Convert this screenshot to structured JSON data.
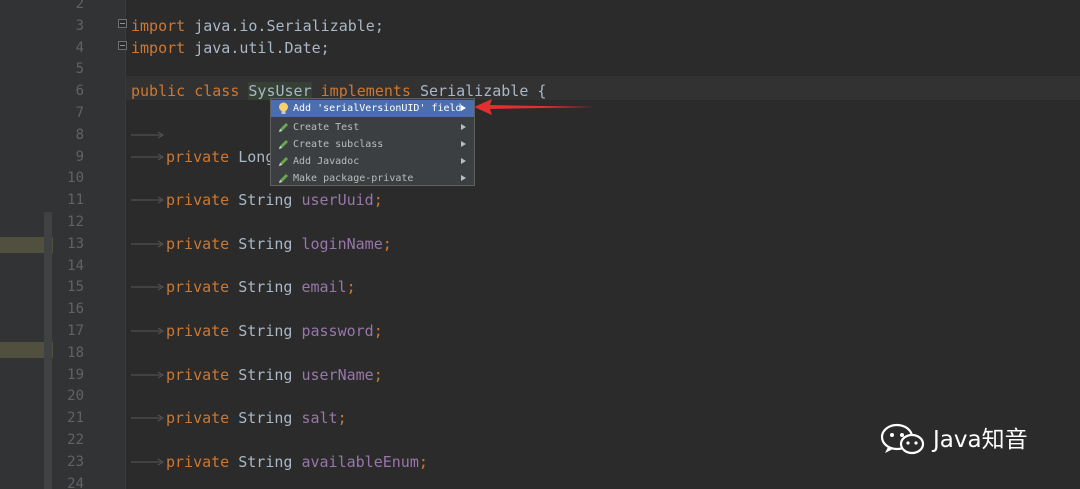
{
  "editor": {
    "lines": [
      {
        "no": "2",
        "tokens": []
      },
      {
        "no": "3",
        "tokens": [
          {
            "t": "import",
            "c": "kw"
          },
          {
            "t": " java.io.Serializable;",
            "c": "p"
          }
        ]
      },
      {
        "no": "4",
        "tokens": [
          {
            "t": "import",
            "c": "kw"
          },
          {
            "t": " java.util.Date;",
            "c": "p"
          }
        ]
      },
      {
        "no": "5",
        "tokens": []
      },
      {
        "no": "6",
        "tokens": [
          {
            "t": "public",
            "c": "kw"
          },
          {
            "t": " ",
            "c": "p"
          },
          {
            "t": "class",
            "c": "kw"
          },
          {
            "t": " ",
            "c": "p"
          },
          {
            "t": "SysUser",
            "c": "cls-hl"
          },
          {
            "t": " ",
            "c": "p"
          },
          {
            "t": "implements",
            "c": "kw"
          },
          {
            "t": " Serializable {",
            "c": "p"
          }
        ]
      },
      {
        "no": "7",
        "tokens": []
      },
      {
        "no": "8",
        "tokens": []
      },
      {
        "no": "9",
        "tokens": [
          {
            "t": "private",
            "c": "kw"
          },
          {
            "t": " Long",
            "c": "p"
          }
        ]
      },
      {
        "no": "10",
        "tokens": []
      },
      {
        "no": "11",
        "tokens": [
          {
            "t": "private",
            "c": "kw"
          },
          {
            "t": " String ",
            "c": "p"
          },
          {
            "t": "userUuid",
            "c": "fld"
          },
          {
            "t": ";",
            "c": "kw"
          }
        ]
      },
      {
        "no": "12",
        "tokens": []
      },
      {
        "no": "13",
        "tokens": [
          {
            "t": "private",
            "c": "kw"
          },
          {
            "t": " String ",
            "c": "p"
          },
          {
            "t": "loginName",
            "c": "fld"
          },
          {
            "t": ";",
            "c": "kw"
          }
        ]
      },
      {
        "no": "14",
        "tokens": []
      },
      {
        "no": "15",
        "tokens": [
          {
            "t": "private",
            "c": "kw"
          },
          {
            "t": " String ",
            "c": "p"
          },
          {
            "t": "email",
            "c": "fld"
          },
          {
            "t": ";",
            "c": "kw"
          }
        ]
      },
      {
        "no": "16",
        "tokens": []
      },
      {
        "no": "17",
        "tokens": [
          {
            "t": "private",
            "c": "kw"
          },
          {
            "t": " String ",
            "c": "p"
          },
          {
            "t": "password",
            "c": "fld"
          },
          {
            "t": ";",
            "c": "kw"
          }
        ]
      },
      {
        "no": "18",
        "tokens": []
      },
      {
        "no": "19",
        "tokens": [
          {
            "t": "private",
            "c": "kw"
          },
          {
            "t": " String ",
            "c": "p"
          },
          {
            "t": "userName",
            "c": "fld"
          },
          {
            "t": ";",
            "c": "kw"
          }
        ]
      },
      {
        "no": "20",
        "tokens": []
      },
      {
        "no": "21",
        "tokens": [
          {
            "t": "private",
            "c": "kw"
          },
          {
            "t": " String ",
            "c": "p"
          },
          {
            "t": "salt",
            "c": "fld"
          },
          {
            "t": ";",
            "c": "kw"
          }
        ]
      },
      {
        "no": "22",
        "tokens": []
      },
      {
        "no": "23",
        "tokens": [
          {
            "t": "private",
            "c": "kw"
          },
          {
            "t": " String ",
            "c": "p"
          },
          {
            "t": "availableEnum",
            "c": "fld"
          },
          {
            "t": ";",
            "c": "kw"
          }
        ]
      },
      {
        "no": "24",
        "tokens": []
      }
    ]
  },
  "intention_popup": {
    "items": [
      {
        "label": "Add 'serialVersionUID' field",
        "icon": "lightbulb-icon",
        "selected": true
      },
      {
        "label": "Create Test",
        "icon": "pencil-icon",
        "selected": false
      },
      {
        "label": "Create subclass",
        "icon": "pencil-icon",
        "selected": false
      },
      {
        "label": "Add Javadoc",
        "icon": "pencil-icon",
        "selected": false
      },
      {
        "label": "Make package-private",
        "icon": "pencil-icon",
        "selected": false
      }
    ]
  },
  "watermark": {
    "text": "Java知音",
    "icon": "wechat-icon"
  },
  "colors": {
    "background": "#2b2b2b",
    "keyword": "#cc7832",
    "field": "#9876aa",
    "plain": "#a9b7c6",
    "selection": "#4b6eaf",
    "annotation_arrow": "#e03030"
  }
}
